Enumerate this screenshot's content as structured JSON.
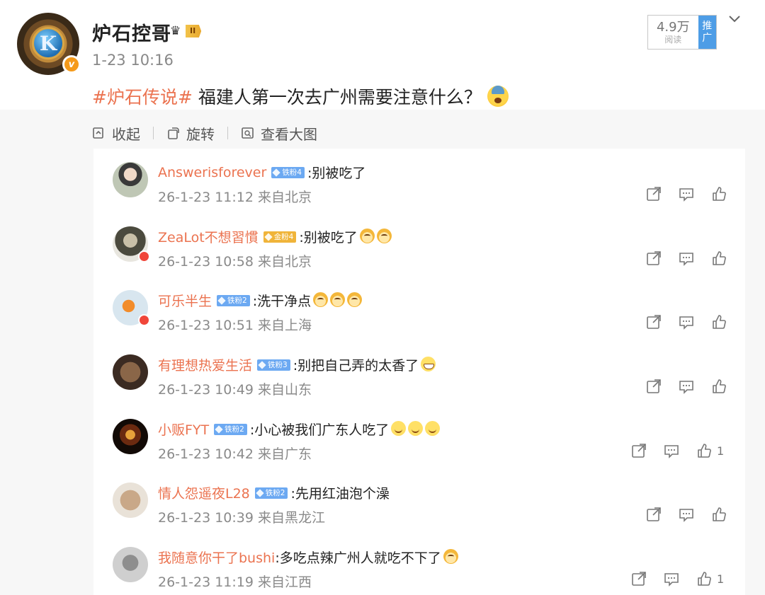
{
  "post": {
    "username": "炉石控哥",
    "level_text": "II",
    "time": "1-23 10:16",
    "read_count": "4.9万",
    "read_label": "阅读",
    "promote_line1": "推",
    "promote_line2": "广",
    "hashtag": "#炉石传说#",
    "text": "福建人第一次去广州需要注意什么？",
    "avatar_letter": "K",
    "verify_mark": "v"
  },
  "toolbar": {
    "collapse_label": "收起",
    "rotate_label": "旋转",
    "view_large_label": "查看大图"
  },
  "comments": [
    {
      "name": "Answerisforever",
      "badge": "铁粉4",
      "badge_type": "iron",
      "text": ":别被吃了",
      "emojis": [],
      "meta": "26-1-23 11:12 来自北京",
      "likes": ""
    },
    {
      "name": "ZeaLot不想習慣",
      "badge": "金粉4",
      "badge_type": "gold",
      "text": ":别被吃了",
      "emojis": [
        "dog",
        "dog"
      ],
      "meta": "26-1-23 10:58 来自北京",
      "likes": ""
    },
    {
      "name": "可乐半生",
      "badge": "铁粉2",
      "badge_type": "iron",
      "text": ":洗干净点",
      "emojis": [
        "dog",
        "dog",
        "dog"
      ],
      "meta": "26-1-23 10:51 来自上海",
      "likes": ""
    },
    {
      "name": "有理想热爱生活",
      "badge": "铁粉3",
      "badge_type": "iron",
      "text": ":别把自己弄的太香了",
      "emojis": [
        "grin"
      ],
      "meta": "26-1-23 10:49 来自山东",
      "likes": ""
    },
    {
      "name": "小贩FYT",
      "badge": "铁粉2",
      "badge_type": "iron",
      "text": ":小心被我们广东人吃了",
      "emojis": [
        "smile",
        "smile",
        "smile"
      ],
      "meta": "26-1-23 10:42 来自广东",
      "likes": "1"
    },
    {
      "name": "情人怨遥夜L28",
      "badge": "铁粉2",
      "badge_type": "iron",
      "text": ":先用红油泡个澡",
      "emojis": [],
      "meta": "26-1-23 10:39 来自黑龙江",
      "likes": ""
    },
    {
      "name": "我随意你干了bushi",
      "badge": "",
      "badge_type": "",
      "text": ":多吃点辣广州人就吃不下了",
      "emojis": [
        "dog"
      ],
      "meta": "26-1-23 11:19 来自江西",
      "likes": "1"
    }
  ],
  "colors": {
    "name_accent": "#eb7350",
    "iron_badge": "#6ca9f2",
    "gold_badge": "#f0b43a",
    "promote": "#4e9de6"
  },
  "icons": [
    "share-icon",
    "comment-icon",
    "like-icon",
    "collapse-icon",
    "rotate-icon",
    "view-large-icon",
    "chevron-down-icon"
  ]
}
